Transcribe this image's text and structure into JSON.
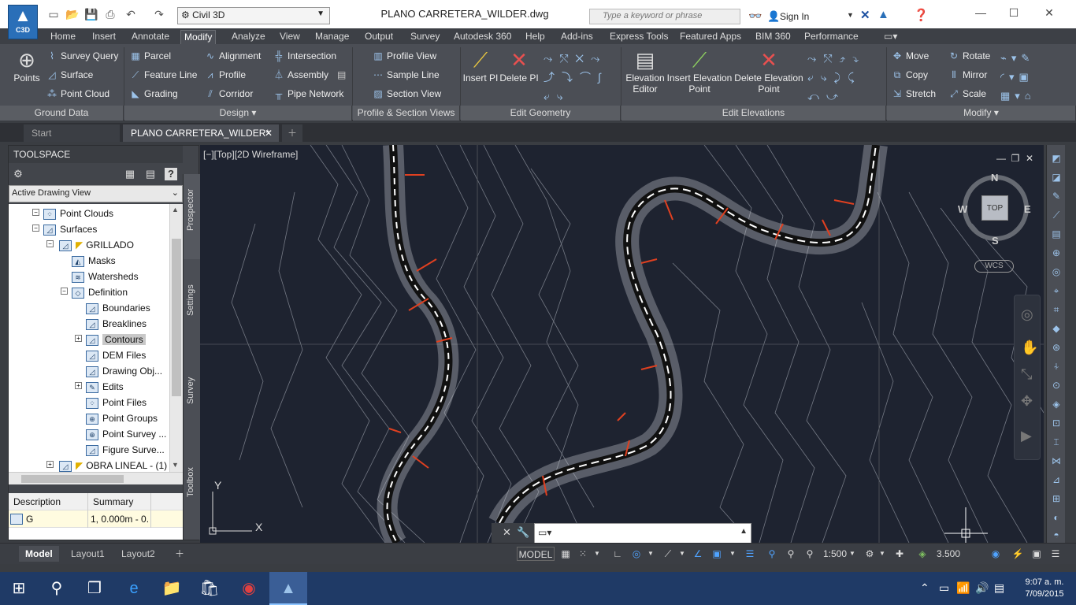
{
  "app": {
    "logo_text": "C3D",
    "workspace": "Civil 3D",
    "title": "PLANO CARRETERA_WILDER.dwg",
    "search_placeholder": "Type a keyword or phrase",
    "sign_in": "Sign In"
  },
  "ribbon_tabs": [
    "Home",
    "Insert",
    "Annotate",
    "Modify",
    "Analyze",
    "View",
    "Manage",
    "Output",
    "Survey",
    "Autodesk 360",
    "Help",
    "Add-ins",
    "Express Tools",
    "Featured Apps",
    "BIM 360",
    "Performance"
  ],
  "active_ribbon_tab": "Modify",
  "ribbon": {
    "ground_data": {
      "title": "Ground Data",
      "points": "Points",
      "survey_query": "Survey Query",
      "surface": "Surface",
      "point_cloud": "Point Cloud"
    },
    "design": {
      "title": "Design",
      "parcel": "Parcel",
      "feature_line": "Feature Line",
      "grading": "Grading",
      "alignment": "Alignment",
      "profile": "Profile",
      "corridor": "Corridor",
      "intersection": "Intersection",
      "assembly": "Assembly",
      "pipe_network": "Pipe Network"
    },
    "profile_section": {
      "title": "Profile & Section Views",
      "profile_view": "Profile View",
      "sample_line": "Sample Line",
      "section_view": "Section View"
    },
    "edit_geometry": {
      "title": "Edit Geometry",
      "insert_pi": "Insert PI",
      "delete_pi": "Delete PI"
    },
    "edit_elevations": {
      "title": "Edit Elevations",
      "elevation_editor_1": "Elevation",
      "elevation_editor_2": "Editor",
      "insert_elev_1": "Insert Elevation",
      "insert_elev_2": "Point",
      "delete_elev_1": "Delete Elevation",
      "delete_elev_2": "Point"
    },
    "modify": {
      "title": "Modify",
      "move": "Move",
      "copy": "Copy",
      "stretch": "Stretch",
      "rotate": "Rotate",
      "mirror": "Mirror",
      "scale": "Scale"
    }
  },
  "file_tabs": [
    "Start",
    "PLANO CARRETERA_WILDER*"
  ],
  "toolspace": {
    "title": "TOOLSPACE",
    "view": "Active Drawing View",
    "side_tabs": [
      "Prospector",
      "Settings",
      "Survey",
      "Toolbox"
    ],
    "tree": [
      {
        "label": "Point Clouds"
      },
      {
        "label": "Surfaces"
      },
      {
        "label": "GRILLADO"
      },
      {
        "label": "Masks"
      },
      {
        "label": "Watersheds"
      },
      {
        "label": "Definition"
      },
      {
        "label": "Boundaries"
      },
      {
        "label": "Breaklines"
      },
      {
        "label": "Contours"
      },
      {
        "label": "DEM Files"
      },
      {
        "label": "Drawing Obj..."
      },
      {
        "label": "Edits"
      },
      {
        "label": "Point Files"
      },
      {
        "label": "Point Groups"
      },
      {
        "label": "Point Survey ..."
      },
      {
        "label": "Figure Surve..."
      },
      {
        "label": "OBRA LINEAL - (1)"
      }
    ],
    "columns": [
      "Description",
      "Summary"
    ],
    "row": {
      "description": "G",
      "summary": "1, 0.000m - 0.("
    }
  },
  "viewport": {
    "label": "[−][Top][2D Wireframe]",
    "compass": {
      "n": "N",
      "s": "S",
      "e": "E",
      "w": "W",
      "top": "TOP"
    },
    "wcs": "WCS",
    "ucs_x": "X",
    "ucs_y": "Y"
  },
  "status": {
    "layouts": [
      "Model",
      "Layout1",
      "Layout2"
    ],
    "model": "MODEL",
    "scale": "1:500",
    "lineweight": "3.500"
  },
  "taskbar": {
    "time": "9:07 a. m.",
    "date": "7/09/2015"
  },
  "colors": {
    "ribbon": "#4b4e55",
    "viewport": "#1e2330",
    "taskbar": "#1f3a66",
    "accent": "#2a6fb8"
  }
}
